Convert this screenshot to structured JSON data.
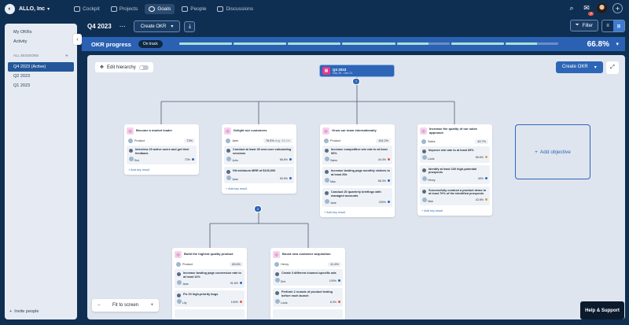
{
  "org": {
    "name": "ALLO, Inc"
  },
  "nav": [
    {
      "label": "Cockpit",
      "active": false
    },
    {
      "label": "Projects",
      "active": false
    },
    {
      "label": "Goals",
      "active": true
    },
    {
      "label": "People",
      "active": false
    },
    {
      "label": "Discussions",
      "active": false
    }
  ],
  "notifications_count": "7",
  "sidebar": {
    "items": [
      "My OKRs",
      "Activity"
    ],
    "sessions_label": "ALL SESSIONS",
    "sessions": [
      "Q4 2023 (Active)",
      "Q2 2023",
      "Q1 2023"
    ],
    "invite": "Invite people"
  },
  "header": {
    "period": "Q4 2023",
    "create_okr": "Create OKR",
    "filter": "Filter"
  },
  "progress": {
    "label": "OKR progress",
    "status": "On track",
    "percent": "66.8%",
    "segments": 7
  },
  "canvas": {
    "edit_hierarchy": "Edit hierarchy",
    "create_okr": "Create OKR",
    "root_title": "Q4 2023",
    "root_dates": "Sep 25 - Dec 21",
    "root_count": "7",
    "child_count": "2",
    "add_objective": "Add objective",
    "fit_to_screen": "Fit to screen",
    "add_key_result": "Add key result"
  },
  "objectives": [
    {
      "title": "Become a market leader",
      "owner": "Product",
      "progress": "73%",
      "krs": [
        {
          "title": "Interview 20 active users and get their feedback",
          "owner": "Emi",
          "progress": "73%",
          "dot": "blue"
        }
      ]
    },
    {
      "title": "Delight our customers",
      "owner": "Jane",
      "progress": "78.5%",
      "extra": "Avg. 93.1%",
      "krs": [
        {
          "title": "Conduct at least 30 new user onboarding sessions",
          "owner": "John",
          "progress": "66.6%",
          "dot": "blue"
        },
        {
          "title": "Hit minimum MRR of $100,000",
          "owner": "Jane",
          "progress": "90.5%",
          "dot": "blue"
        }
      ]
    },
    {
      "title": "Grow our team internationally",
      "owner": "Product",
      "progress": "104.2%",
      "krs": [
        {
          "title": "Increase competitive win rate to at least 90%",
          "owner": "Sales",
          "progress": "44.4%",
          "dot": "red"
        },
        {
          "title": "Increase landing page monthly visitors to at least 20k",
          "owner": "Max",
          "progress": "68.3%",
          "dot": "blue"
        },
        {
          "title": "Conduct 20 quarterly briefings with managed accounts",
          "owner": "Jane",
          "progress": "200%",
          "dot": "blue"
        }
      ]
    },
    {
      "title": "Increase the quality of our sales approach",
      "owner": "Sales",
      "progress": "49.7%",
      "krs": [
        {
          "title": "Improve win rate to at least 65%",
          "owner": "Louis",
          "progress": "66.6%",
          "dot": "org"
        },
        {
          "title": "Identify at least 100 high-potential prospects",
          "owner": "Henry",
          "progress": "40%",
          "dot": "blue"
        },
        {
          "title": "Successfully conduct a product demo to at least 70% of the identified prospects",
          "owner": "Nick",
          "progress": "42.8%",
          "dot": "org"
        }
      ]
    },
    {
      "title": "Build the highest quality product",
      "owner": "Product",
      "progress": "83.6%",
      "krs": [
        {
          "title": "Increase landing page conversion rate to at least 12%",
          "owner": "Jane",
          "progress": "91.6%",
          "dot": "blue"
        },
        {
          "title": "Fix 20 high-priority bugs",
          "owner": "Lily",
          "progress": "100%",
          "dot": "red"
        },
        {
          "title": "",
          "owner": "",
          "progress": "",
          "dot": ""
        }
      ]
    },
    {
      "title": "Boost new customer acquisition",
      "owner": "Henry",
      "progress": "41.6%",
      "krs": [
        {
          "title": "Create 3 different channel-specific ads",
          "owner": "Emi",
          "progress": "100%",
          "dot": "blue"
        },
        {
          "title": "Perform 2 rounds of product testing before each launch",
          "owner": "Louis",
          "progress": "8.3%",
          "dot": "red"
        },
        {
          "title": "",
          "owner": "",
          "progress": "",
          "dot": ""
        }
      ]
    }
  ],
  "zoom": {
    "minus": "−",
    "plus": "+"
  },
  "help": "Help & Support"
}
